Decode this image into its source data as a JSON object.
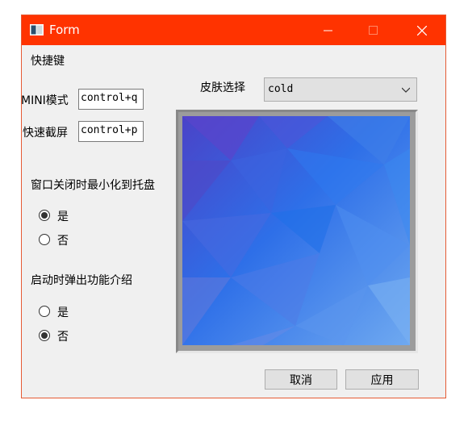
{
  "window": {
    "title": "Form",
    "accent_color": "#ff3300"
  },
  "shortcuts": {
    "section_label": "快捷键",
    "mini_mode_label": "MINI模式",
    "mini_mode_value": "control+q",
    "screenshot_label": "快速截屏",
    "screenshot_value": "control+p"
  },
  "close_to_tray": {
    "label": "窗口关闭时最小化到托盘",
    "options": [
      "是",
      "否"
    ],
    "selected": "是"
  },
  "startup_intro": {
    "label": "启动时弹出功能介绍",
    "options": [
      "是",
      "否"
    ],
    "selected": "否"
  },
  "skin": {
    "label": "皮肤选择",
    "selected": "cold"
  },
  "buttons": {
    "cancel": "取消",
    "apply": "应用"
  }
}
